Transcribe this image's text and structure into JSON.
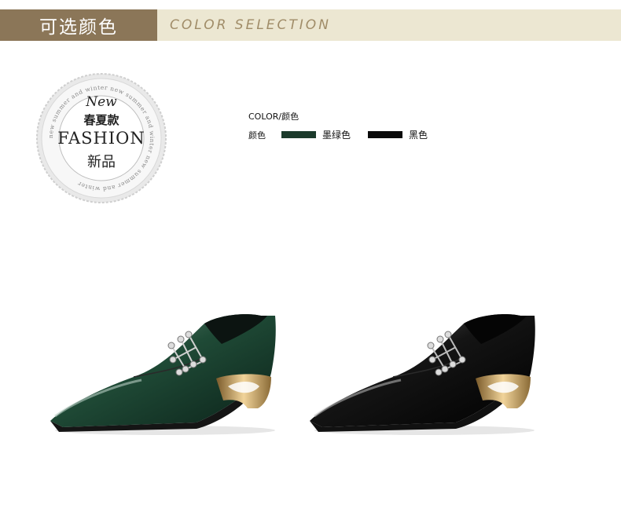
{
  "header": {
    "title_cn": "可选颜色",
    "title_en": "COLOR SELECTION",
    "colors": {
      "left_bg": "#8b7658",
      "right_bg": "#ece7d2",
      "right_text": "#a08c68"
    }
  },
  "stamp": {
    "new": "New",
    "season": "春夏款",
    "fashion": "FASHION",
    "new_item": "新品",
    "ring_text": "new summer and winter new summer and winter new summer and winter"
  },
  "color_info": {
    "title": "COLOR/颜色",
    "row_label": "颜色",
    "options": [
      {
        "name": "墨绿色",
        "swatch": "#1b3a2b"
      },
      {
        "name": "黑色",
        "swatch": "#0a0a0a"
      }
    ]
  },
  "products": [
    {
      "icon": "green-loafer-icon",
      "color": "#1f4a36"
    },
    {
      "icon": "black-loafer-icon",
      "color": "#0e0e0e"
    }
  ]
}
